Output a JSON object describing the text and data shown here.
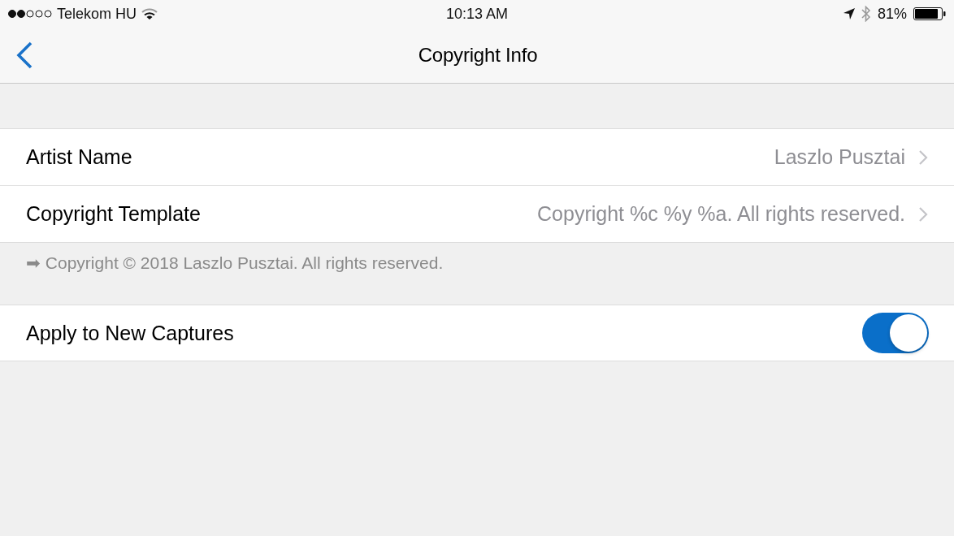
{
  "status_bar": {
    "carrier": "Telekom HU",
    "time": "10:13 AM",
    "battery": "81%"
  },
  "nav_bar": {
    "title": "Copyright Info"
  },
  "sections": [
    {
      "rows": [
        {
          "kind": "disclosure",
          "label": "Artist Name",
          "value": "Laszlo Pusztai"
        },
        {
          "kind": "disclosure",
          "label": "Copyright Template",
          "value": "Copyright %c %y %a. All rights reserved."
        }
      ],
      "footer": "➡ Copyright © 2018 Laszlo Pusztai. All rights reserved."
    },
    {
      "rows": [
        {
          "kind": "toggle",
          "label": "Apply to New Captures",
          "on": true
        }
      ]
    }
  ]
}
